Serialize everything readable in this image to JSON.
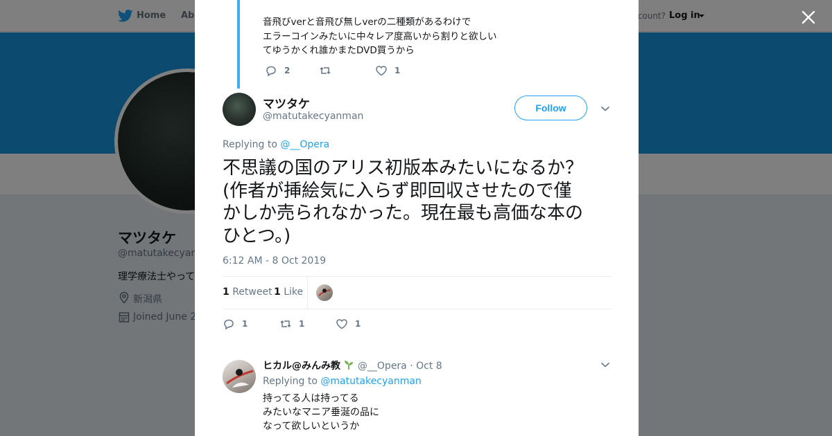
{
  "nav": {
    "home_label": "Home",
    "about_label": "Abo",
    "account_prompt": "ccount?",
    "login_label": "Log in"
  },
  "profile": {
    "name": "マツタケ",
    "handle": "@matutakecyanm",
    "bio": "理学療法士やって",
    "location": "新潟県",
    "joined": "Joined June 2"
  },
  "colors": {
    "accent": "#1da1f2",
    "banner": "#1b95e0",
    "text": "#14171a",
    "muted": "#657786"
  },
  "previous_tweet": {
    "lines": [
      "音飛びverと音飛び無しverの二種類があるわけで",
      "エラーコインみたいに中々レア度高いから割りと欲しい",
      "てゆうかくれ誰かまたDVD買うから"
    ],
    "reply_count": "2",
    "retweet_count": "",
    "like_count": "1"
  },
  "tweet": {
    "author_name": "マツタケ",
    "author_handle": "@matutakecyanman",
    "follow_label": "Follow",
    "replying_prefix": "Replying to",
    "replying_to": "@__Opera",
    "text_lines": [
      "不思議の国のアリス初版本みたいになるか？",
      "(作者が挿絵気に入らず即回収させたので僅",
      "かしか売られなかった。現在最も高価な本の",
      "ひとつ。)"
    ],
    "timestamp": "6:12 AM - 8 Oct 2019",
    "retweets_count": "1",
    "retweets_label": "Retweet",
    "likes_count": "1",
    "likes_label": "Like",
    "reply_count": "1",
    "retweet_count": "1",
    "like_count": "1"
  },
  "reply": {
    "author_name": "ヒカル@みんみ教",
    "name_emoji": "seedling-icon",
    "author_handle": "@__Opera",
    "separator": "·",
    "date": "Oct 8",
    "replying_prefix": "Replying to",
    "replying_to": "@matutakecyanman",
    "text_lines": [
      "持ってる人は持ってる",
      "みたいなマニア垂涎の品に",
      "なって欲しいというか"
    ]
  }
}
